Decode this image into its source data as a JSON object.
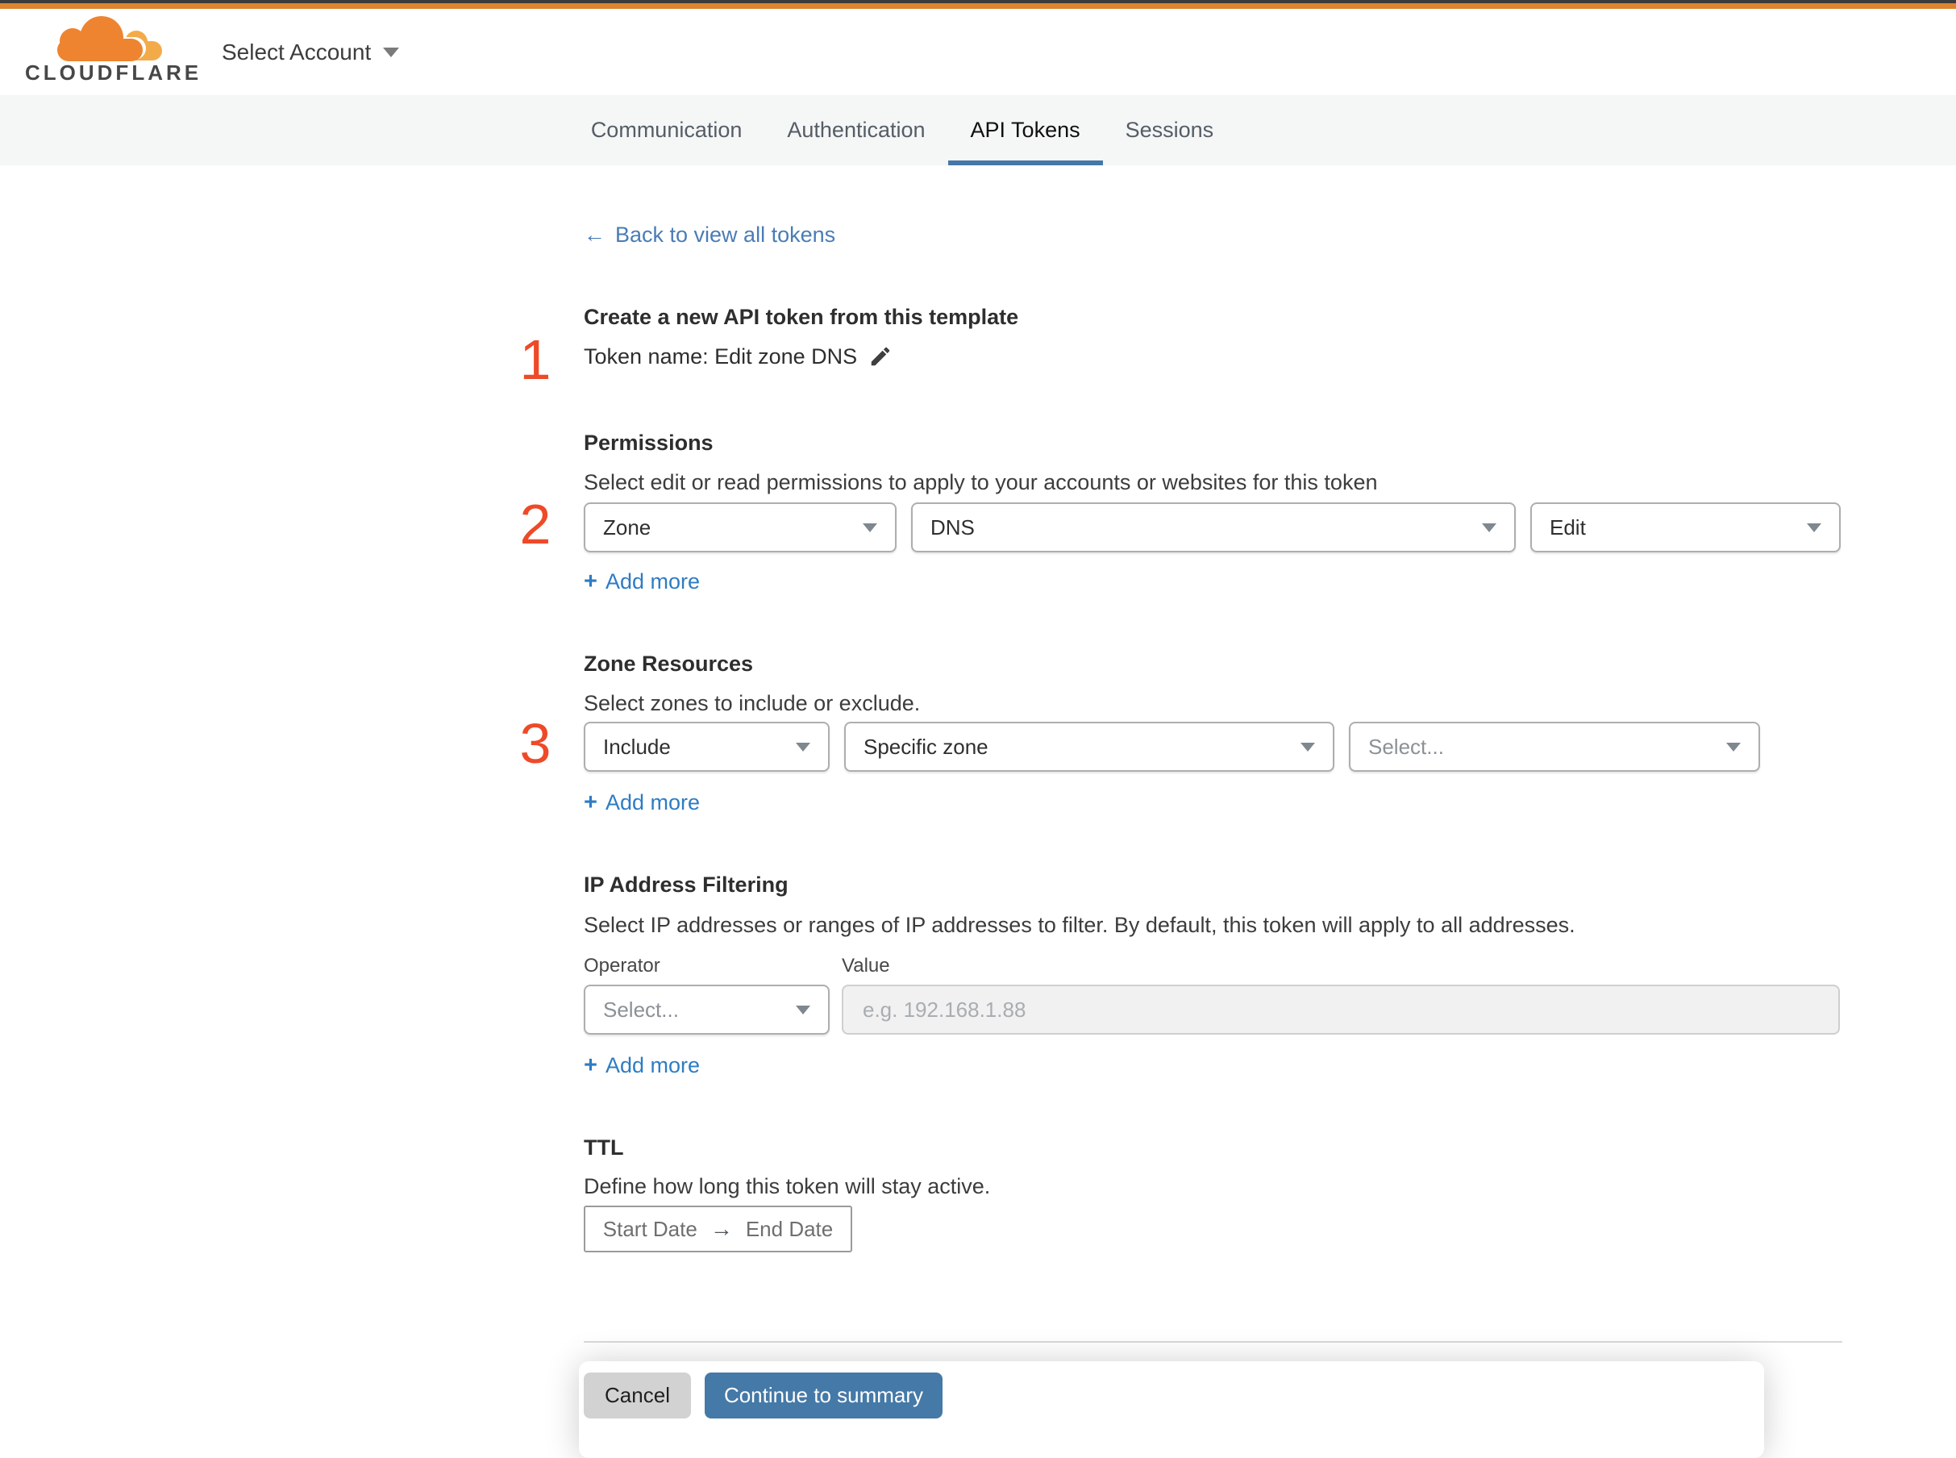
{
  "colors": {
    "brand_orange": "#dd8430",
    "accent_blue": "#4478a8",
    "link_blue": "#3a7cbe",
    "step_red": "#ee4a28"
  },
  "header": {
    "logo_text": "CLOUDFLARE",
    "account_selector": "Select Account"
  },
  "tabs": [
    {
      "label": "Communication",
      "active": false
    },
    {
      "label": "Authentication",
      "active": false
    },
    {
      "label": "API Tokens",
      "active": true
    },
    {
      "label": "Sessions",
      "active": false
    }
  ],
  "back_link": {
    "arrow": "←",
    "label": "Back to view all tokens"
  },
  "token_template": {
    "step": "1",
    "title": "Create a new API token from this template",
    "token_name": "Token name: Edit zone DNS"
  },
  "permissions": {
    "step": "2",
    "title": "Permissions",
    "description": "Select edit or read permissions to apply to your accounts or websites for this token",
    "scope_value": "Zone",
    "resource_value": "DNS",
    "access_value": "Edit"
  },
  "zone_resources": {
    "step": "3",
    "title": "Zone Resources",
    "description": "Select zones to include or exclude.",
    "mode_value": "Include",
    "type_value": "Specific zone",
    "zone_placeholder": "Select..."
  },
  "ip_filtering": {
    "title": "IP Address Filtering",
    "description": "Select IP addresses or ranges of IP addresses to filter. By default, this token will apply to all addresses.",
    "operator_label": "Operator",
    "value_label": "Value",
    "operator_placeholder": "Select...",
    "value_placeholder": "e.g. 192.168.1.88"
  },
  "ttl": {
    "title": "TTL",
    "description": "Define how long this token will stay active.",
    "start_date": "Start Date",
    "arrow": "→",
    "end_date": "End Date"
  },
  "add_more": {
    "plus": "+",
    "label": "Add more"
  },
  "footer": {
    "cancel_label": "Cancel",
    "continue_label": "Continue to summary"
  }
}
